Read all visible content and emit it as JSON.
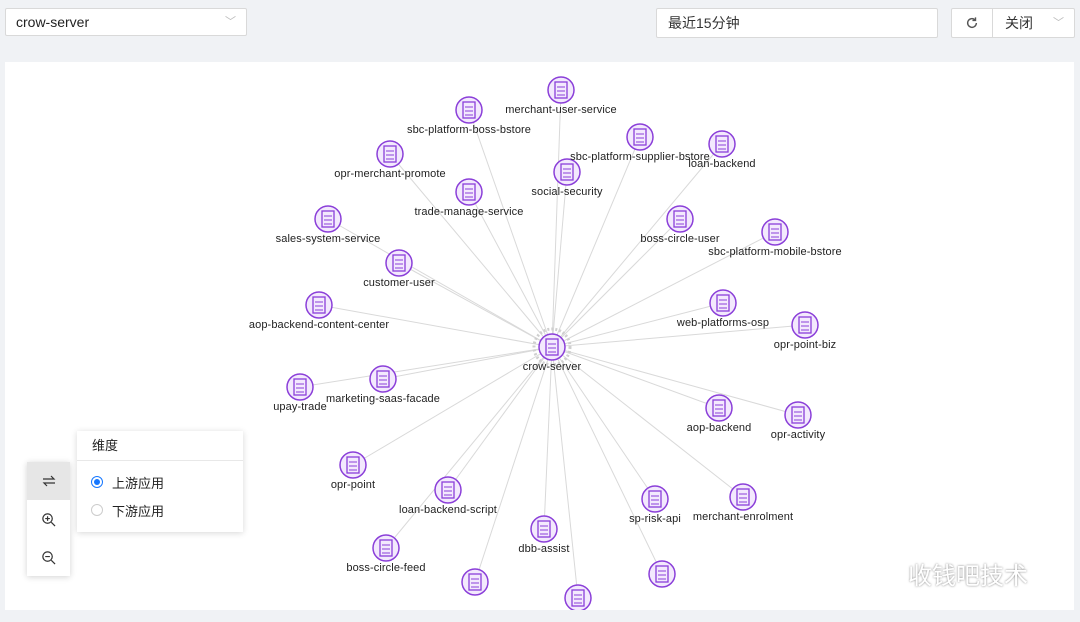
{
  "service_select": {
    "value": "crow-server"
  },
  "time_range": {
    "value": "最近15分钟"
  },
  "refresh": {
    "value": "关闭"
  },
  "graph": {
    "center": "crow-server",
    "nodes": [
      "merchant-user-service",
      "sbc-platform-boss-bstore",
      "sbc-platform-supplier-bstore",
      "loan-backend",
      "opr-merchant-promote",
      "social-security",
      "trade-manage-service",
      "boss-circle-user",
      "sbc-platform-mobile-bstore",
      "sales-system-service",
      "customer-user",
      "aop-backend-content-center",
      "web-platforms-osp",
      "opr-point-biz",
      "marketing-saas-facade",
      "upay-trade",
      "aop-backend",
      "opr-activity",
      "opr-point",
      "loan-backend-script",
      "merchant-enrolment",
      "sp-risk-api",
      "dbb-assist",
      "boss-circle-feed"
    ]
  },
  "dimension_panel": {
    "title": "维度",
    "options": [
      "上游应用",
      "下游应用"
    ],
    "selected": "上游应用"
  },
  "toolbar": {
    "icons": [
      "swap-icon",
      "zoom-in-icon",
      "zoom-out-icon"
    ]
  },
  "watermark": {
    "text": "收钱吧技术"
  },
  "colors": {
    "node": "#8b3fd9",
    "node_fill": "#f3e9fd",
    "edge": "#d9d9d9"
  }
}
